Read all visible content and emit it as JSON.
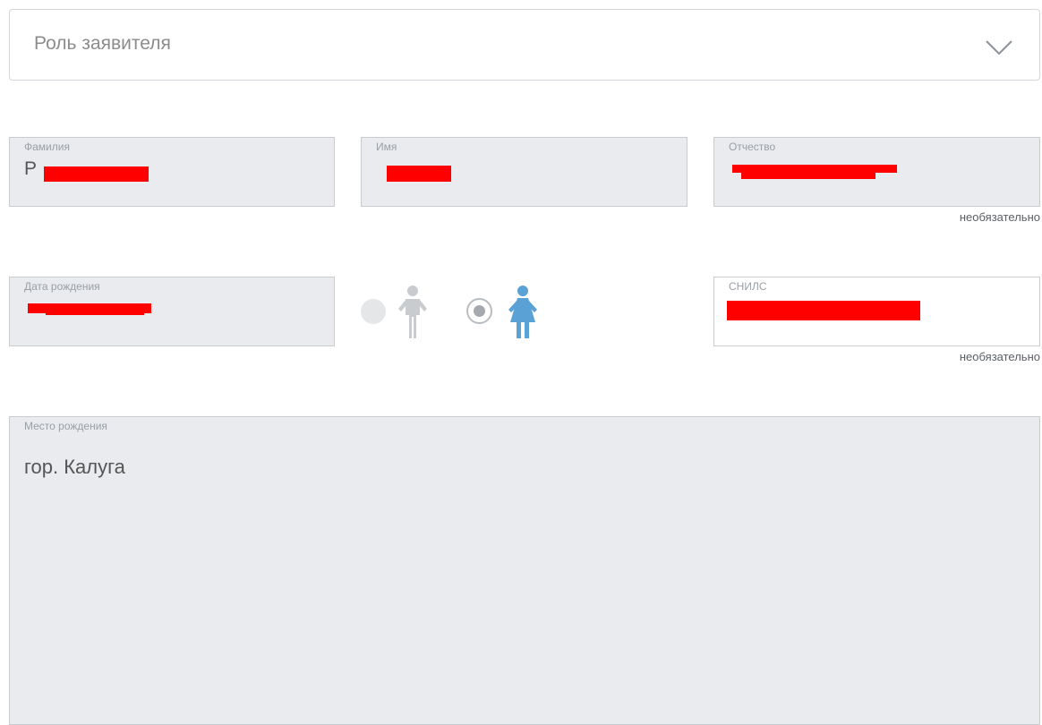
{
  "role_select": {
    "placeholder": "Роль заявителя",
    "icon": "chevron-down-icon"
  },
  "fields": {
    "surname": {
      "label": "Фамилия",
      "value": "Р"
    },
    "name": {
      "label": "Имя",
      "value": ""
    },
    "patronymic": {
      "label": "Отчество",
      "value": "",
      "hint": "необязательно"
    },
    "birth_date": {
      "label": "Дата рождения",
      "value": ""
    },
    "snils": {
      "label": "СНИЛС",
      "value": "",
      "hint": "необязательно"
    },
    "birth_place": {
      "label": "Место рождения",
      "value": "гор. Калуга"
    }
  },
  "gender": {
    "options": [
      {
        "id": "male",
        "icon": "male-figure-icon",
        "selected": false,
        "color": "#c9cccf"
      },
      {
        "id": "female",
        "icon": "female-figure-icon",
        "selected": true,
        "color": "#5aa2d6"
      }
    ]
  },
  "colors": {
    "field_bg": "#e9ebee",
    "redaction": "#ff0000",
    "accent": "#5aa2d6"
  }
}
